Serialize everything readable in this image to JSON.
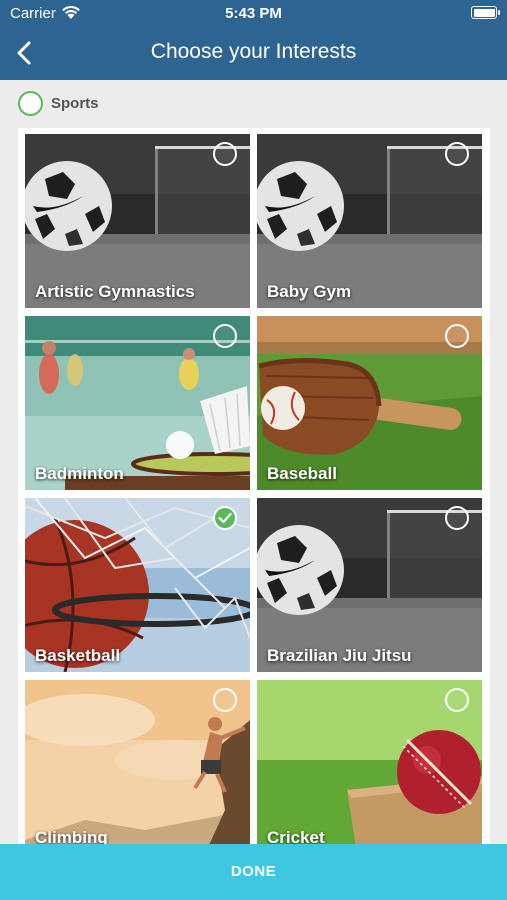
{
  "status_bar": {
    "carrier": "Carrier",
    "time": "5:43 PM"
  },
  "nav": {
    "title": "Choose your Interests"
  },
  "section": {
    "label": "Sports",
    "selected": false
  },
  "tiles": [
    {
      "label": "Artistic Gymnastics",
      "selected": false,
      "image": "soccer-ball-photo"
    },
    {
      "label": "Baby Gym",
      "selected": false,
      "image": "soccer-ball-photo"
    },
    {
      "label": "Badminton",
      "selected": false,
      "image": "badminton-photo"
    },
    {
      "label": "Baseball",
      "selected": false,
      "image": "baseball-glove-photo"
    },
    {
      "label": "Basketball",
      "selected": true,
      "image": "basketball-net-photo"
    },
    {
      "label": "Brazilian Jiu Jitsu",
      "selected": false,
      "image": "soccer-ball-photo"
    },
    {
      "label": "Climbing",
      "selected": false,
      "image": "rock-climber-photo"
    },
    {
      "label": "Cricket",
      "selected": false,
      "image": "cricket-ball-photo"
    }
  ],
  "done_label": "DONE",
  "colors": {
    "nav": "#2e6491",
    "done": "#3fc7e2",
    "check": "#5cb85c"
  }
}
